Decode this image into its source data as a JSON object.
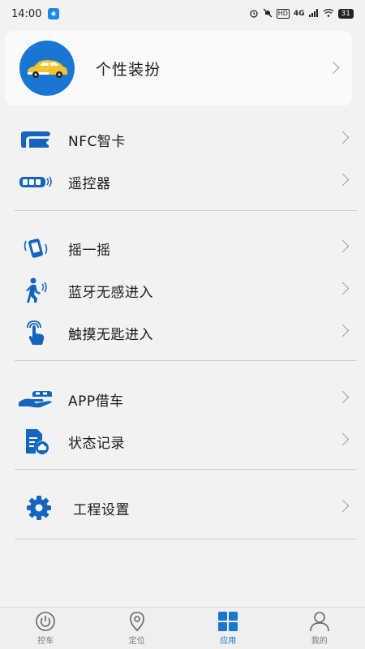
{
  "status_bar": {
    "time": "14:00",
    "network": "4G",
    "hd": "HD",
    "battery": "31"
  },
  "header": {
    "title": "个性装扮"
  },
  "menu": {
    "nfc": "NFC智卡",
    "remote": "遥控器",
    "shake": "摇一摇",
    "bluetooth": "蓝牙无感进入",
    "touch": "触摸无匙进入",
    "app_rent": "APP借车",
    "status_log": "状态记录",
    "settings": "工程设置"
  },
  "tabs": [
    {
      "label": "控车",
      "icon": "power-icon",
      "active": false
    },
    {
      "label": "定位",
      "icon": "location-icon",
      "active": false
    },
    {
      "label": "应用",
      "icon": "apps-grid-icon",
      "active": true
    },
    {
      "label": "我的",
      "icon": "user-icon",
      "active": false
    }
  ],
  "colors": {
    "accent": "#1976d2",
    "background": "#f2f2f2",
    "inactive_tab": "#777777"
  }
}
